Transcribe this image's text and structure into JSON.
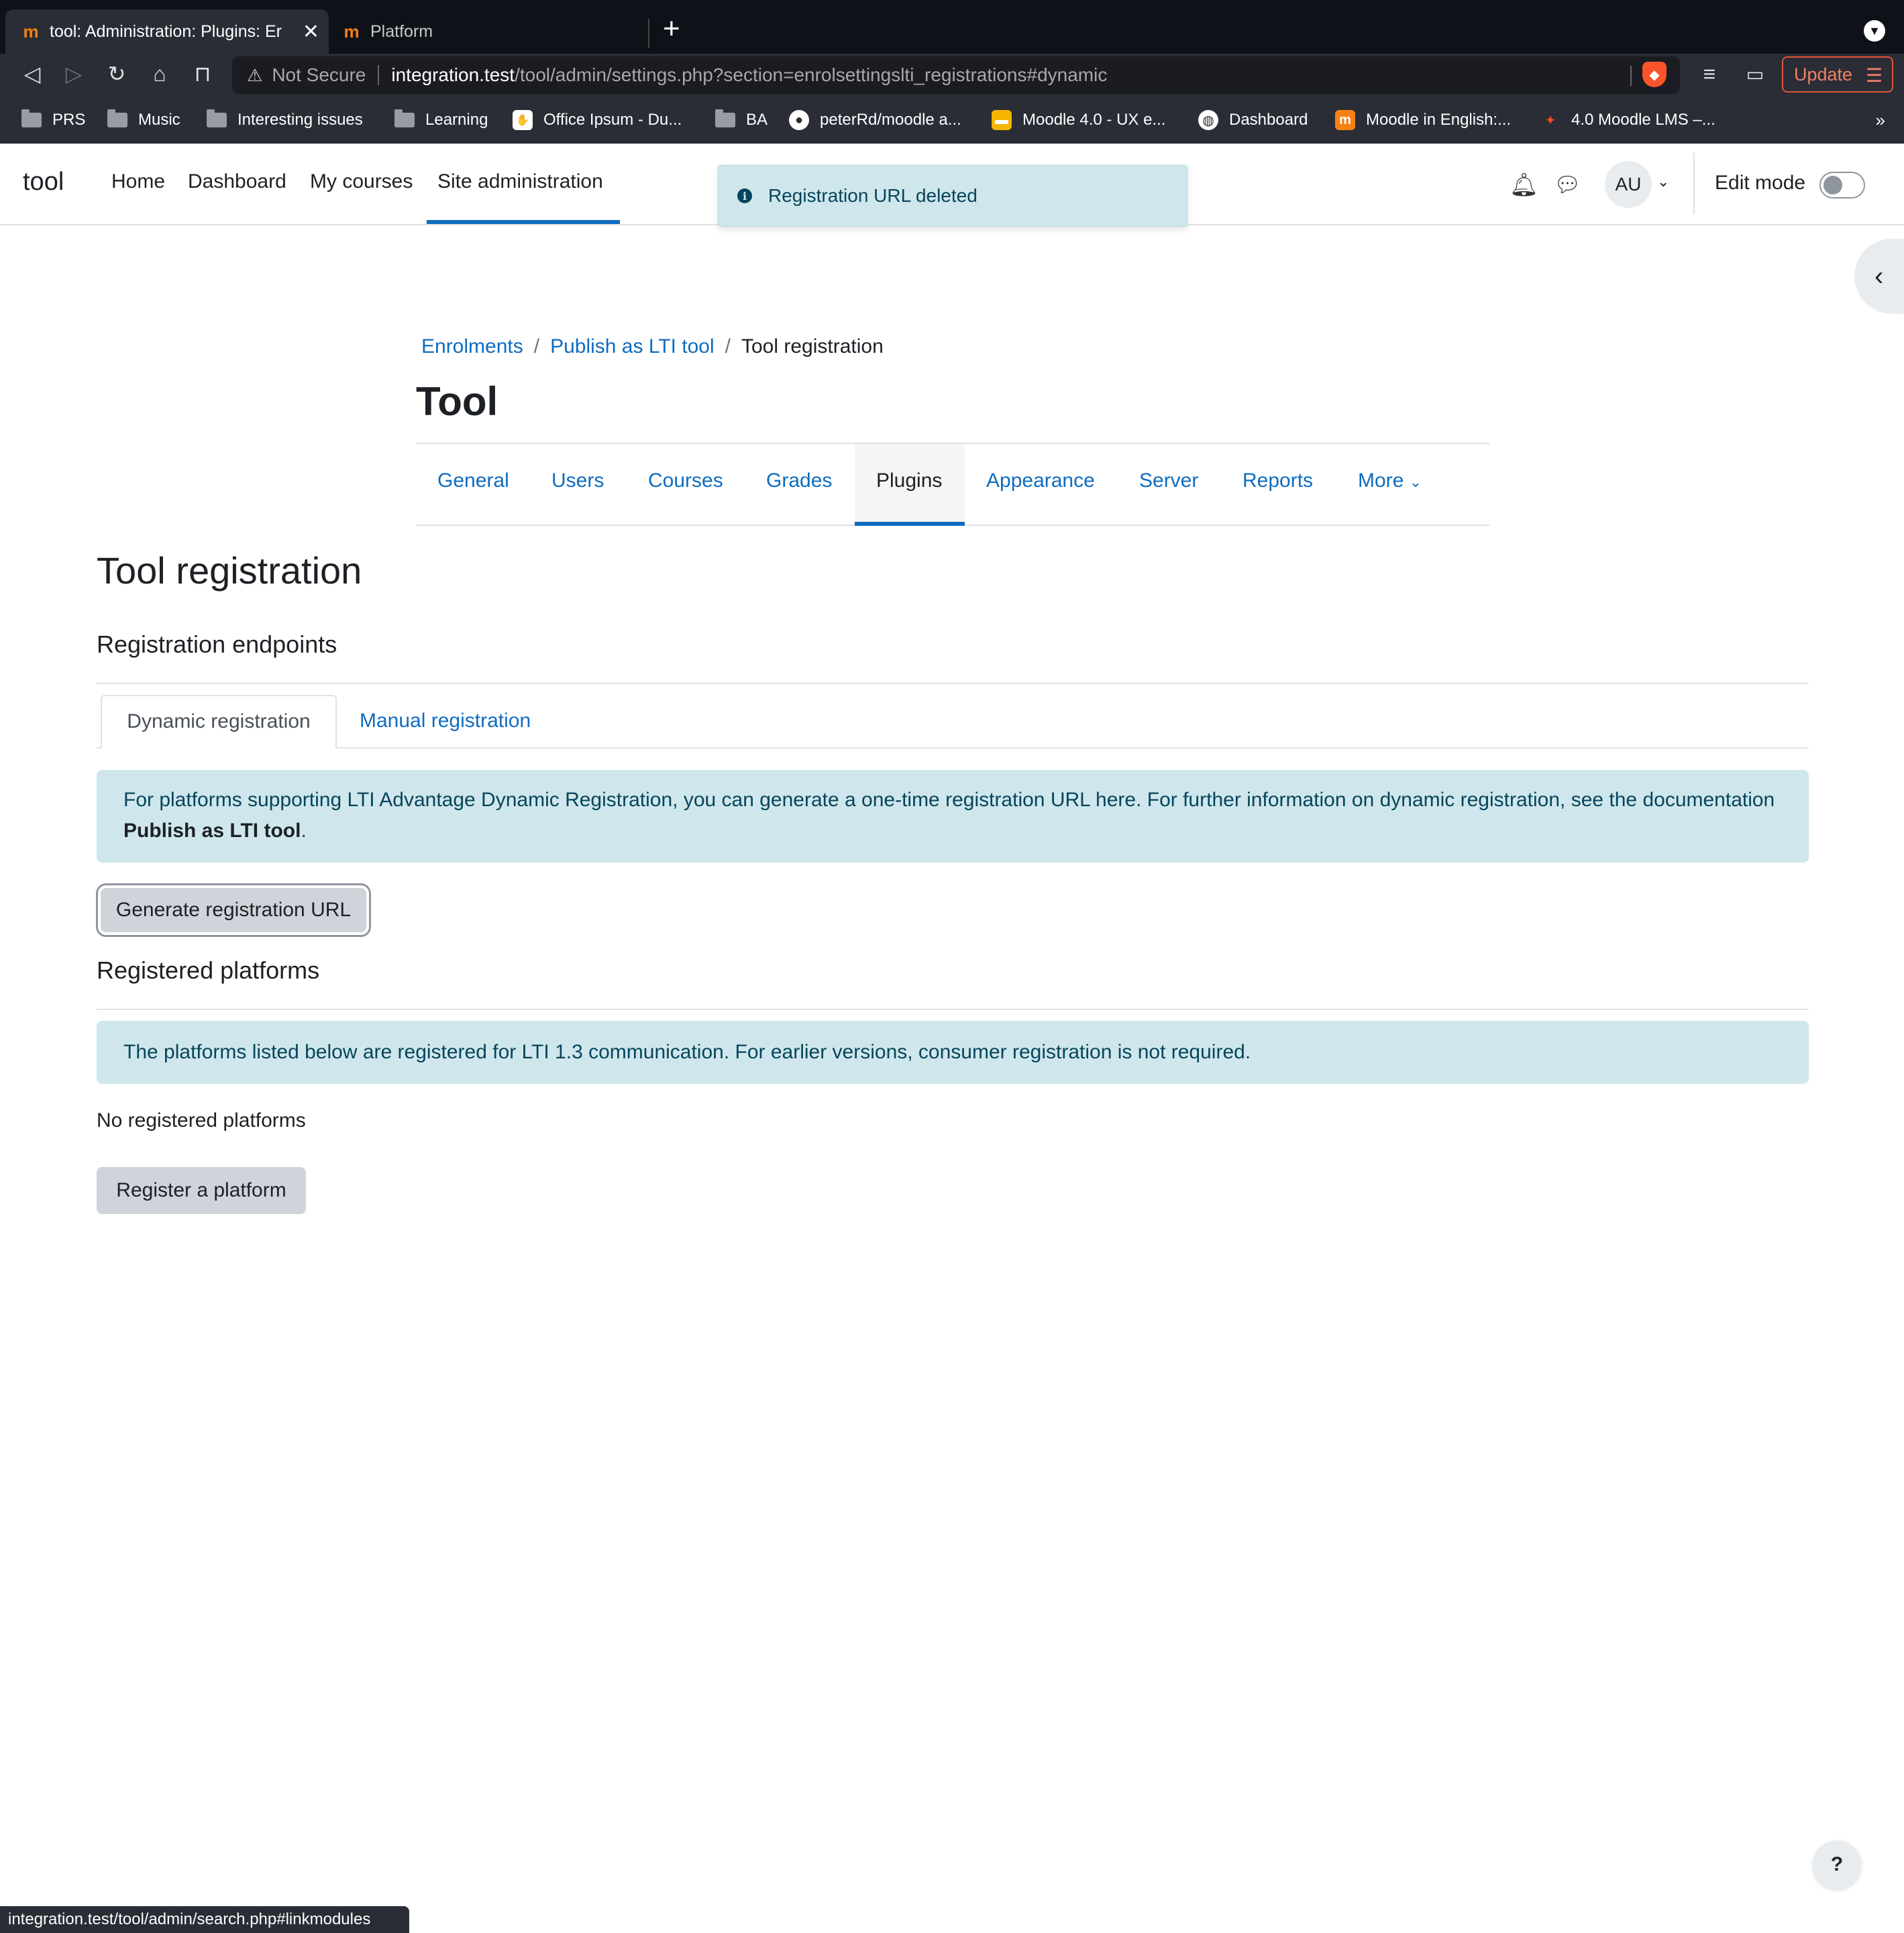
{
  "browser": {
    "tabs": [
      {
        "title": "tool: Administration: Plugins: Er",
        "active": true,
        "favicon": "moodle-icon"
      },
      {
        "title": "Platform",
        "active": false,
        "favicon": "moodle-icon"
      }
    ],
    "new_tab": "+",
    "address": {
      "warning": "Not Secure",
      "host": "integration.test",
      "path": "/tool/admin/settings.php?section=enrolsettingslti_registrations#dynamic"
    },
    "update_label": "Update",
    "bookmarks": [
      {
        "label": "PRS",
        "icon": "folder-icon"
      },
      {
        "label": "Music",
        "icon": "folder-icon"
      },
      {
        "label": "Interesting issues",
        "icon": "folder-icon"
      },
      {
        "label": "Learning",
        "icon": "folder-icon"
      },
      {
        "label": "Office Ipsum - Du...",
        "icon": "bookmark-favicon-icon"
      },
      {
        "label": "BA",
        "icon": "folder-icon"
      },
      {
        "label": "peterRd/moodle a...",
        "icon": "github-icon"
      },
      {
        "label": "Moodle 4.0 - UX e...",
        "icon": "slides-icon"
      },
      {
        "label": "Dashboard",
        "icon": "globe-icon"
      },
      {
        "label": "Moodle in English:...",
        "icon": "moodle-icon"
      },
      {
        "label": "4.0 Moodle LMS –...",
        "icon": "figma-icon"
      }
    ],
    "bookmarks_more": "»",
    "status_url": "integration.test/tool/admin/search.php#linkmodules"
  },
  "navbar": {
    "brand": "tool",
    "items": [
      "Home",
      "Dashboard",
      "My courses",
      "Site administration"
    ],
    "active_item": "Site administration",
    "avatar_initials": "AU",
    "edit_mode_label": "Edit mode",
    "edit_mode_on": false
  },
  "toast": {
    "message": "Registration URL deleted"
  },
  "breadcrumb": [
    {
      "label": "Enrolments",
      "link": true
    },
    {
      "label": "Publish as LTI tool",
      "link": true
    },
    {
      "label": "Tool registration",
      "link": false
    }
  ],
  "page_heading": "Tool",
  "secondary_nav": {
    "items": [
      "General",
      "Users",
      "Courses",
      "Grades",
      "Plugins",
      "Appearance",
      "Server",
      "Reports",
      "More"
    ],
    "active": "Plugins"
  },
  "main": {
    "title": "Tool registration",
    "endpoints_heading": "Registration endpoints",
    "tabs": [
      {
        "label": "Dynamic registration",
        "active": true
      },
      {
        "label": "Manual registration",
        "active": false
      }
    ],
    "dynamic_info_prefix": "For platforms supporting LTI Advantage Dynamic Registration, you can generate a one-time registration URL here. For further information on dynamic registration, see the documentation ",
    "dynamic_info_link": "Publish as LTI tool",
    "dynamic_info_suffix": ".",
    "generate_button": "Generate registration URL",
    "platforms_heading": "Registered platforms",
    "platforms_info": "The platforms listed below are registered for LTI 1.3 communication. For earlier versions, consumer registration is not required.",
    "no_platforms": "No registered platforms",
    "register_button": "Register a platform"
  },
  "help_button": "?",
  "colors": {
    "link": "#0f6cbf",
    "alert_bg": "#cfe7ec",
    "alert_text": "#06455c",
    "button_bg": "#ced4da"
  }
}
